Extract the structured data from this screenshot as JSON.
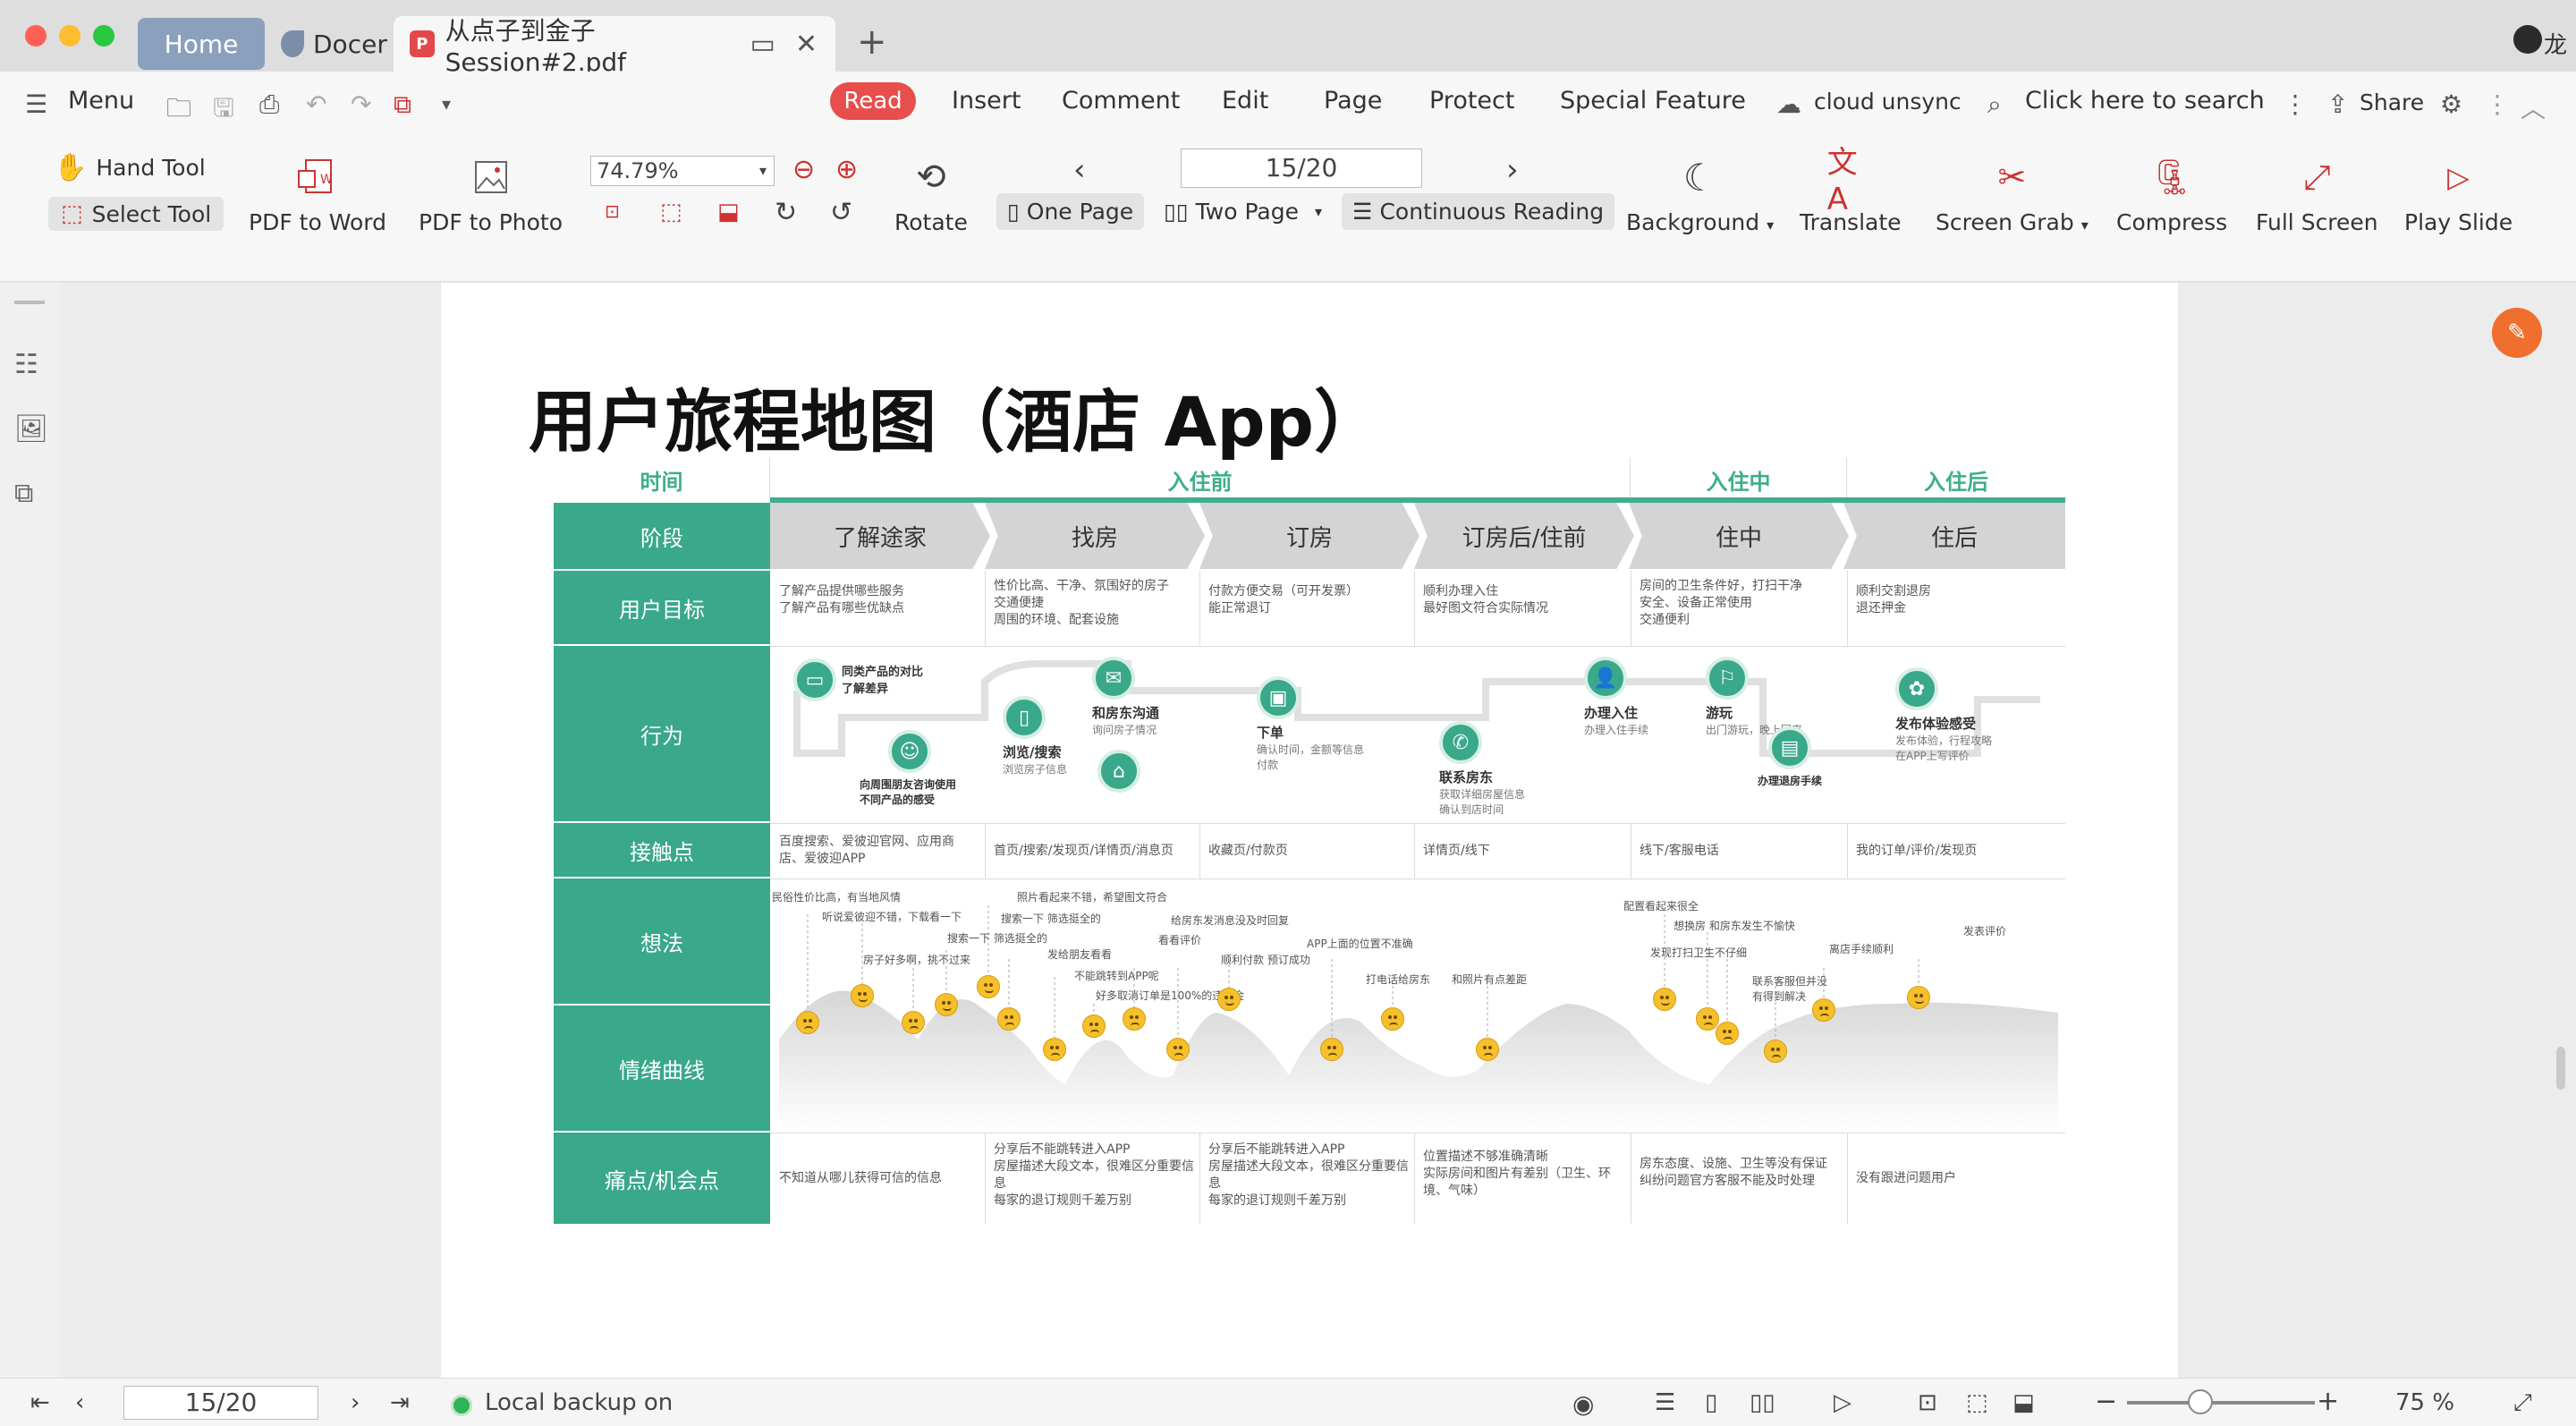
{
  "window": {
    "tabs": [
      {
        "label": "Home"
      },
      {
        "label": "Docer"
      },
      {
        "label": "从点子到金子Session#2.pdf"
      }
    ],
    "user_name": "龙"
  },
  "menubar": {
    "menu_label": "Menu",
    "tabs": [
      "Read",
      "Insert",
      "Comment",
      "Edit",
      "Page",
      "Protect",
      "Special Feature"
    ],
    "cloud_status": "cloud unsync",
    "search_placeholder": "Click here to search",
    "share_label": "Share"
  },
  "toolbar": {
    "hand_tool": "Hand Tool",
    "select_tool": "Select Tool",
    "pdf_to_word": "PDF to Word",
    "pdf_to_photo": "PDF to Photo",
    "zoom": "74.79%",
    "rotate": "Rotate",
    "page_indicator": "15/20",
    "one_page": "One Page",
    "two_page": "Two Page",
    "continuous_reading": "Continuous Reading",
    "background": "Background",
    "translate": "Translate",
    "screen_grab": "Screen Grab",
    "compress": "Compress",
    "full_screen": "Full Screen",
    "play_slide": "Play Slide"
  },
  "document": {
    "title": "用户旅程地图（酒店 App）",
    "time_header": "时间",
    "phases": [
      "入住前",
      "入住中",
      "入住后"
    ],
    "row_labels": [
      "阶段",
      "用户目标",
      "行为",
      "接触点",
      "想法",
      "情绪曲线",
      "痛点/机会点"
    ],
    "stages": [
      "了解途家",
      "找房",
      "订房",
      "订房后/住前",
      "住中",
      "住后"
    ],
    "goals": [
      "了解产品提供哪些服务\n了解产品有哪些优缺点",
      "性价比高、干净、氛围好的房子\n交通便捷\n周围的环境、配套设施",
      "付款方便交易（可开发票）\n能正常退订",
      "顺利办理入住\n最好图文符合实际情况",
      "房间的卫生条件好，打扫干净\n安全、设备正常使用\n交通便利",
      "顺利交割退房\n退还押金"
    ],
    "actions": [
      {
        "title": "同类产品的对比\n了解差异",
        "desc": ""
      },
      {
        "title": "向周围朋友咨询使用不同产品的感受",
        "desc": ""
      },
      {
        "title": "浏览/搜索",
        "desc": "浏览房子信息"
      },
      {
        "title": "和房东沟通",
        "desc": "询问房子情况"
      },
      {
        "title": "",
        "desc": ""
      },
      {
        "title": "下单",
        "desc": "确认时间，金额等信息付款"
      },
      {
        "title": "联系房东",
        "desc": "获取详细房屋信息\n确认到店时间"
      },
      {
        "title": "办理入住",
        "desc": "办理入住手续"
      },
      {
        "title": "游玩",
        "desc": "出门游玩，晚上回来"
      },
      {
        "title": "办理退房手续",
        "desc": ""
      },
      {
        "title": "发布体验感受",
        "desc": "发布体验，行程攻略\n在APP上写评价"
      }
    ],
    "touchpoints": [
      "百度搜索、爱彼迎官网、应用商店、爱彼迎APP",
      "首页/搜索/发现页/详情页/消息页",
      "收藏页/付款页",
      "详情页/线下",
      "线下/客服电话",
      "我的订单/评价/发现页"
    ],
    "thoughts": [
      "民俗性价比高，有当地风情",
      "听说爱彼迎不错，下载看一下",
      "房子好多啊，挑不过来",
      "搜索一下 筛选挺全的",
      "照片看起来不错，希望图文符合",
      "搜索一下 筛选挺全的",
      "发给朋友看看",
      "不能跳转到APP呢",
      "好多取消订单是100%的违约金",
      "给房东发消息没及时回复",
      "看看评价",
      "顺利付款 预订成功",
      "APP上面的位置不准确",
      "打电话给房东",
      "和照片有点差距",
      "配置看起来很全",
      "想换房 和房东发生不愉快",
      "发现打扫卫生不仔细",
      "联系客服但并没有得到解决",
      "离店手续顺利",
      "发表评价"
    ],
    "emotions": [
      {
        "mood": "sad"
      },
      {
        "mood": "happy"
      },
      {
        "mood": "sad"
      },
      {
        "mood": "happy"
      },
      {
        "mood": "happy"
      },
      {
        "mood": "sad"
      },
      {
        "mood": "sad"
      },
      {
        "mood": "sad"
      },
      {
        "mood": "sad"
      },
      {
        "mood": "sad"
      },
      {
        "mood": "happy"
      },
      {
        "mood": "sad"
      },
      {
        "mood": "sad"
      },
      {
        "mood": "sad"
      },
      {
        "mood": "happy"
      },
      {
        "mood": "sad"
      },
      {
        "mood": "sad"
      },
      {
        "mood": "sad"
      },
      {
        "mood": "sad"
      },
      {
        "mood": "happy"
      }
    ],
    "pain_points": [
      "不知道从哪儿获得可信的信息",
      "分享后不能跳转进入APP\n房屋描述大段文本，很难区分重要信息\n每家的退订规则千差万别",
      "分享后不能跳转进入APP\n房屋描述大段文本，很难区分重要信息\n每家的退订规则千差万别",
      "位置描述不够准确清晰\n实际房间和图片有差别（卫生、环境、气味）",
      "房东态度、设施、卫生等没有保证\n纠纷问题官方客服不能及时处理",
      "没有跟进问题用户"
    ]
  },
  "statusbar": {
    "page_indicator": "15/20",
    "backup_status": "Local backup on",
    "zoom": "75 %"
  },
  "colors": {
    "accent_red": "#e84e4b",
    "teal": "#3aa88a",
    "tab_home": "#8aa0bd"
  }
}
